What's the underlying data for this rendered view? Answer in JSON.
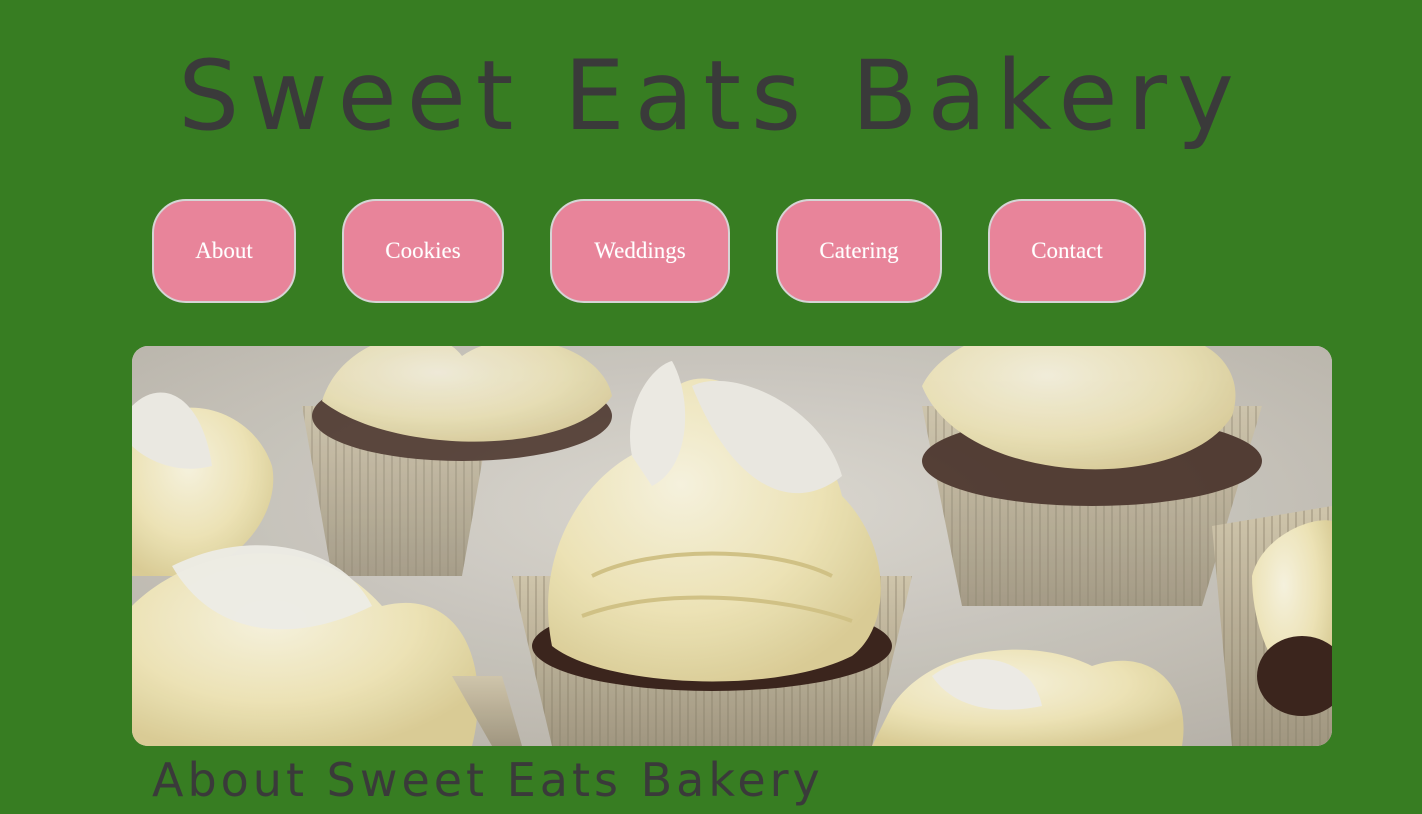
{
  "header": {
    "title": "Sweet Eats Bakery"
  },
  "nav": {
    "items": [
      {
        "label": "About"
      },
      {
        "label": "Cookies"
      },
      {
        "label": "Weddings"
      },
      {
        "label": "Catering"
      },
      {
        "label": "Contact"
      }
    ]
  },
  "hero": {
    "image": "cupcakes-photo"
  },
  "about": {
    "heading": "About Sweet Eats Bakery"
  },
  "colors": {
    "background": "#377d22",
    "nav_button": "#e8849a",
    "nav_border": "#d5d5d5",
    "heading_text": "#3a3a3a",
    "nav_text": "#ffffff"
  }
}
